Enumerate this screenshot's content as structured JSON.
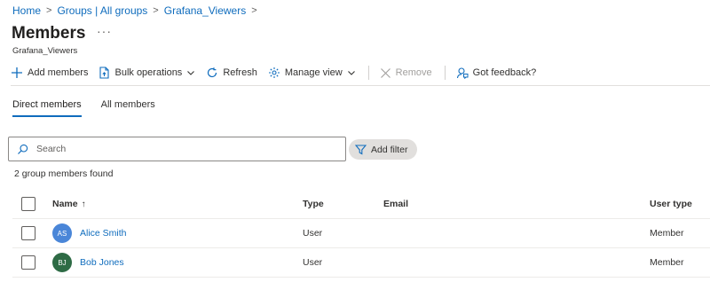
{
  "breadcrumb": {
    "items": [
      "Home",
      "Groups | All groups",
      "Grafana_Viewers"
    ],
    "separator": ">"
  },
  "page": {
    "title": "Members",
    "more": "···",
    "subtitle": "Grafana_Viewers"
  },
  "toolbar": {
    "add_members": "Add members",
    "bulk_operations": "Bulk operations",
    "refresh": "Refresh",
    "manage_view": "Manage view",
    "remove": "Remove",
    "feedback": "Got feedback?"
  },
  "tabs": [
    {
      "label": "Direct members",
      "active": true
    },
    {
      "label": "All members",
      "active": false
    }
  ],
  "search": {
    "placeholder": "Search"
  },
  "filter": {
    "label": "Add filter"
  },
  "result_count": "2 group members found",
  "table": {
    "columns": {
      "name": "Name",
      "sort_indicator": "↑",
      "type": "Type",
      "email": "Email",
      "user_type": "User type"
    },
    "rows": [
      {
        "initials": "AS",
        "name": "Alice Smith",
        "type": "User",
        "email": "",
        "user_type": "Member",
        "avatar_color": "#4a86d8"
      },
      {
        "initials": "BJ",
        "name": "Bob Jones",
        "type": "User",
        "email": "",
        "user_type": "Member",
        "avatar_color": "#2e6b45"
      }
    ]
  },
  "colors": {
    "accent": "#0f6cbd",
    "divider": "#e1dfdd"
  }
}
